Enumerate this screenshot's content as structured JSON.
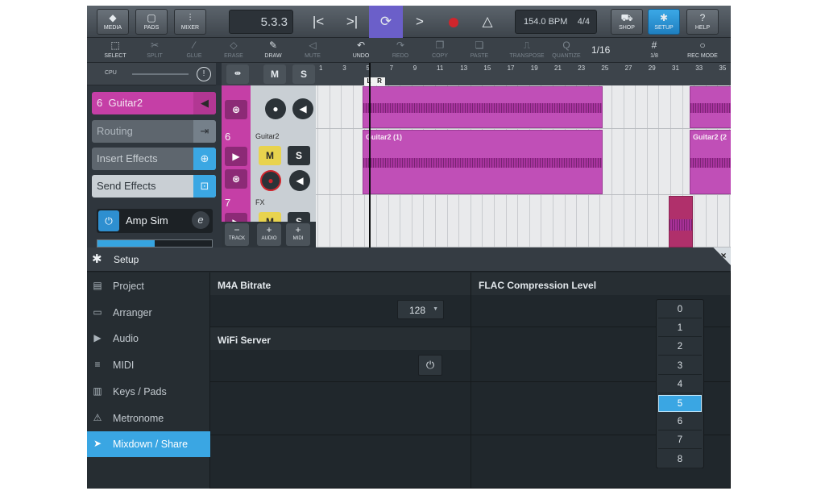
{
  "top_toolbar": {
    "media_label": "MEDIA",
    "pads_label": "PADS",
    "mixer_label": "MIXER",
    "position": "5.3.3",
    "tempo": "154.0 BPM",
    "time_signature": "4/4",
    "shop_label": "SHOP",
    "setup_label": "SETUP",
    "help_label": "HELP"
  },
  "tools": {
    "select": "SELECT",
    "split": "SPLIT",
    "glue": "GLUE",
    "erase": "ERASE",
    "draw": "DRAW",
    "mute": "MUTE",
    "undo": "UNDO",
    "redo": "REDO",
    "copy": "COPY",
    "paste": "PASTE",
    "transpose": "TRANSPOSE",
    "quantize": "QUANTIZE",
    "quantize_value": "1/16",
    "grid_label": "1/8",
    "rec_mode": "REC MODE"
  },
  "inspector": {
    "cpu_label": "CPU",
    "track_number": "6",
    "track_name": "Guitar2",
    "routing": "Routing",
    "insert_effects": "Insert Effects",
    "send_effects": "Send Effects",
    "plugin_name": "Amp Sim",
    "meter_level": 0.5
  },
  "tracks": [
    {
      "number": "6",
      "name": "Guitar2"
    },
    {
      "number": "7",
      "name": "FX"
    }
  ],
  "track_buttons": {
    "mute": "M",
    "solo": "S",
    "track": "TRACK",
    "audio": "AUDIO",
    "midi": "MIDI"
  },
  "ruler": {
    "bars": [
      "1",
      "3",
      "5",
      "7",
      "9",
      "11",
      "13",
      "15",
      "17",
      "19",
      "21",
      "23",
      "25",
      "27",
      "29",
      "31",
      "33",
      "35"
    ],
    "left_marker": "L",
    "right_marker": "R"
  },
  "clips": {
    "clip1": "Guitar2 (1)",
    "clip2": "Guitar2 (2"
  },
  "colors": {
    "accent": "#3aa6e3",
    "track_color": "#c53fa6",
    "loop": "#6b5fc9",
    "record": "#d0252c"
  },
  "setup": {
    "title": "Setup",
    "close": "×",
    "nav": [
      {
        "label": "Project",
        "icon": "project-icon"
      },
      {
        "label": "Arranger",
        "icon": "arranger-icon"
      },
      {
        "label": "Audio",
        "icon": "audio-icon"
      },
      {
        "label": "MIDI",
        "icon": "midi-icon"
      },
      {
        "label": "Keys / Pads",
        "icon": "keys-icon"
      },
      {
        "label": "Metronome",
        "icon": "metronome-icon"
      },
      {
        "label": "Mixdown / Share",
        "icon": "mixdown-icon"
      }
    ],
    "m4a_bitrate_label": "M4A Bitrate",
    "m4a_bitrate_value": "128",
    "flac_label": "FLAC Compression Level",
    "wifi_label": "WiFi Server",
    "flac_options": [
      "0",
      "1",
      "2",
      "3",
      "4",
      "5",
      "6",
      "7",
      "8"
    ],
    "flac_selected": "5"
  }
}
